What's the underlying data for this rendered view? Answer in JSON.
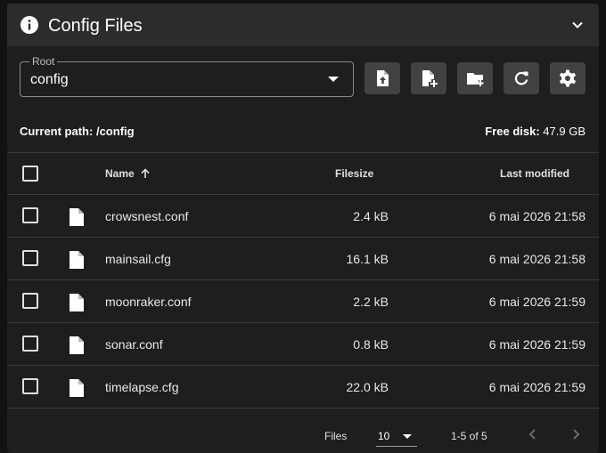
{
  "header": {
    "title": "Config Files",
    "icon": "info-icon",
    "collapse_icon": "chevron-down-icon"
  },
  "root_select": {
    "label": "Root",
    "value": "config"
  },
  "toolbar": [
    {
      "name": "upload-file-button",
      "icon": "file-upload-icon"
    },
    {
      "name": "create-file-button",
      "icon": "file-plus-icon"
    },
    {
      "name": "create-folder-button",
      "icon": "folder-plus-icon"
    },
    {
      "name": "refresh-button",
      "icon": "refresh-icon"
    },
    {
      "name": "settings-button",
      "icon": "gear-icon"
    }
  ],
  "path": {
    "label": "Current path:",
    "value": "/config"
  },
  "disk": {
    "label": "Free disk:",
    "value": "47.9 GB"
  },
  "table": {
    "columns": {
      "name": "Name",
      "filesize": "Filesize",
      "modified": "Last modified"
    },
    "sort": {
      "column": "Name",
      "direction": "ascending"
    },
    "rows": [
      {
        "name": "crowsnest.conf",
        "size": "2.4 kB",
        "modified": "6 mai 2026 21:58"
      },
      {
        "name": "mainsail.cfg",
        "size": "16.1 kB",
        "modified": "6 mai 2026 21:58"
      },
      {
        "name": "moonraker.conf",
        "size": "2.2 kB",
        "modified": "6 mai 2026 21:59"
      },
      {
        "name": "sonar.conf",
        "size": "0.8 kB",
        "modified": "6 mai 2026 21:59"
      },
      {
        "name": "timelapse.cfg",
        "size": "22.0 kB",
        "modified": "6 mai 2026 21:59"
      }
    ]
  },
  "footer": {
    "per_page_label": "Files",
    "per_page_value": "10",
    "range": "1-5 of 5"
  },
  "colors": {
    "background": "#121212",
    "card": "#1e1e1e",
    "header": "#2c2c2c",
    "button": "#424242",
    "divider": "#3a3a3a"
  }
}
